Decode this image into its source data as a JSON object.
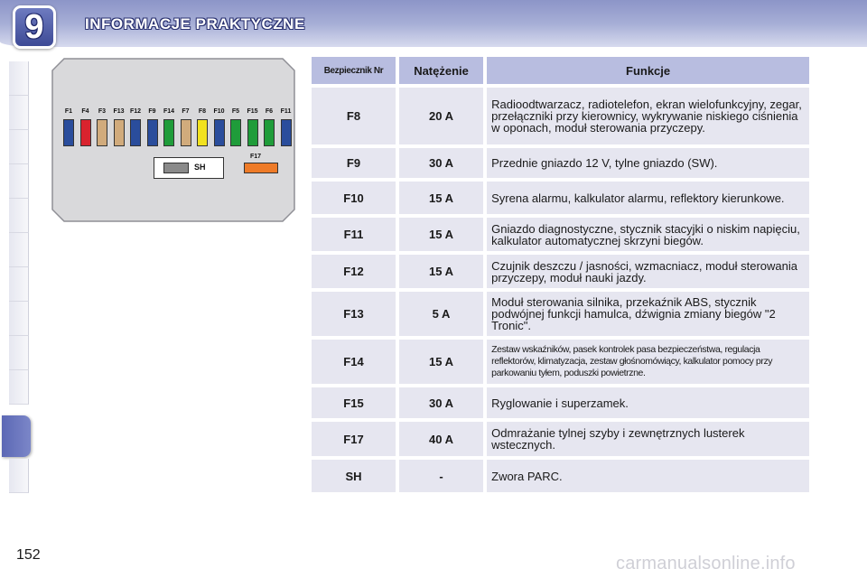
{
  "header": {
    "chapter_number": "9",
    "title": "INFORMACJE PRAKTYCZNE"
  },
  "diagram": {
    "fuse_labels": [
      "F1",
      "F4",
      "F3",
      "F13",
      "F12",
      "F9",
      "F14",
      "F7",
      "F8",
      "F10",
      "F5",
      "F15",
      "F6",
      "F11"
    ],
    "fuse_colors": [
      "#2a4d9c",
      "#d9232e",
      "#d1ab7c",
      "#d1ab7c",
      "#2a4d9c",
      "#2a4d9c",
      "#1f9c3a",
      "#d1ab7c",
      "#f2e21f",
      "#2a4d9c",
      "#1f9c3a",
      "#1f9c3a",
      "#1f9c3a",
      "#2a4d9c"
    ],
    "sh_label": "SH",
    "f17_label": "F17",
    "f17_color": "#ee7b28"
  },
  "table": {
    "headers": [
      "Bezpiecznik Nr",
      "Natężenie",
      "Funkcje"
    ],
    "rows": [
      {
        "fuse": "F8",
        "amp": "20 A",
        "func": "Radioodtwarzacz, radiotelefon, ekran wielofunkcyjny, zegar, przełączniki przy kierownicy, wykrywanie niskiego ciśnienia w oponach, moduł sterowania przyczepy."
      },
      {
        "fuse": "F9",
        "amp": "30 A",
        "func": "Przednie gniazdo 12 V, tylne gniazdo (SW)."
      },
      {
        "fuse": "F10",
        "amp": "15 A",
        "func": "Syrena alarmu, kalkulator alarmu, reflektory kierunkowe."
      },
      {
        "fuse": "F11",
        "amp": "15 A",
        "func": "Gniazdo diagnostyczne, stycznik stacyjki o niskim napięciu, kalkulator automatycznej skrzyni biegów."
      },
      {
        "fuse": "F12",
        "amp": "15 A",
        "func": "Czujnik deszczu / jasności, wzmacniacz, moduł sterowania przyczepy, moduł nauki jazdy."
      },
      {
        "fuse": "F13",
        "amp": "5 A",
        "func": "Moduł sterowania silnika, przekaźnik ABS, stycznik podwójnej funkcji hamulca, dźwignia zmiany biegów \"2 Tronic\"."
      },
      {
        "fuse": "F14",
        "amp": "15 A",
        "func": "Zestaw wskaźników, pasek kontrolek pasa bezpieczeństwa, regulacja reflektorów, klimatyzacja, zestaw głośnomówiący, kalkulator pomocy przy parkowaniu tyłem, poduszki powietrzne."
      },
      {
        "fuse": "F15",
        "amp": "30 A",
        "func": "Ryglowanie i superzamek."
      },
      {
        "fuse": "F17",
        "amp": "40 A",
        "func": "Odmrażanie tylnej szyby i zewnętrznych lusterek wstecznych."
      },
      {
        "fuse": "SH",
        "amp": "-",
        "func": "Zwora PARC."
      }
    ]
  },
  "footer": {
    "page_number": "152",
    "watermark": "carmanualsonline.info"
  },
  "colors": {
    "header_bar": "#a6aed6",
    "badge": "#4a57a3",
    "table_header_bg": "#b8bde0",
    "table_cell_bg": "#e6e6f0",
    "diagram_bg": "#d9d9db"
  }
}
